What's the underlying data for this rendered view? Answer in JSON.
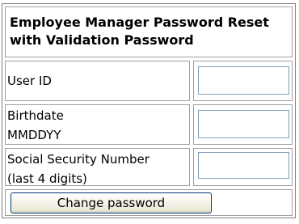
{
  "form": {
    "title": "Employee Manager Password Reset with Validation Password",
    "fields": [
      {
        "label_line1": "User ID",
        "label_line2": "",
        "value": ""
      },
      {
        "label_line1": "Birthdate",
        "label_line2": "MMDDYY",
        "value": ""
      },
      {
        "label_line1": "Social Security Number",
        "label_line2": "(last 4 digits)",
        "value": ""
      }
    ],
    "submit_label": "Change password"
  }
}
